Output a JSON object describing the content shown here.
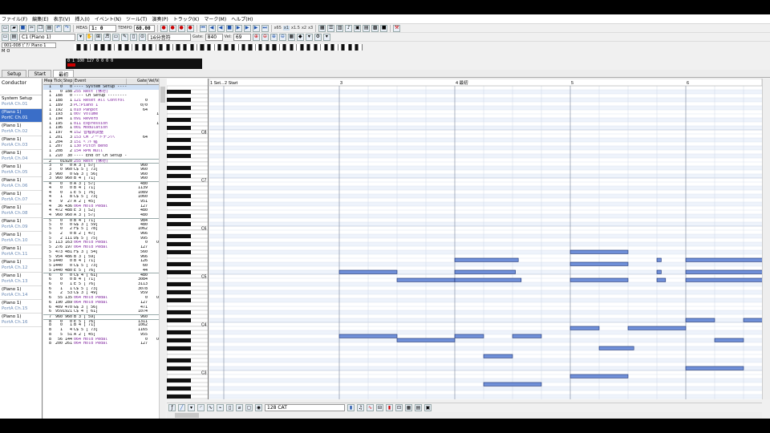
{
  "menu": [
    "ファイル(F)",
    "編集(E)",
    "表示(V)",
    "挿入(I)",
    "イベント(N)",
    "ツール(T)",
    "演奏(P)",
    "トラック(K)",
    "マーク(M)",
    "ヘルプ(H)"
  ],
  "transport": {
    "meas_label": "MEAS",
    "position": "1:   0",
    "tempo_label": "TEMPO",
    "tempo": "60.00",
    "buttons": [
      "x65",
      "x1",
      "x1.5",
      "x2",
      "x3"
    ]
  },
  "toolbar2": {
    "track_select": "C1 (Piano 1)",
    "quantize": "16分音符",
    "gate_label": "Gate:",
    "gate": "840",
    "vel_label": "Vel:",
    "vel": "69"
  },
  "trackinfo": {
    "name": "001-008 ﾋﾟｱﾉ Piano 1",
    "m": "M",
    "o": "O",
    "rows": [
      "0  1  100 127  0  0  0  0",
      "M  O"
    ]
  },
  "tabs": [
    "Setup",
    "Start",
    "最初"
  ],
  "tracks": {
    "header": "Conductor",
    "items": [
      {
        "name": "System Setup",
        "sub": "PortA Ch.01",
        "sel": false
      },
      {
        "name": "(Piano 1)",
        "sub": "PortC Ch.01",
        "sel": true
      },
      {
        "name": "(Piano 1)",
        "sub": "PortA Ch.02",
        "sel": false
      },
      {
        "name": "(Piano 1)",
        "sub": "PortA Ch.03",
        "sel": false
      },
      {
        "name": "(Piano 1)",
        "sub": "PortA Ch.04",
        "sel": false
      },
      {
        "name": "(Piano 1)",
        "sub": "PortA Ch.05",
        "sel": false
      },
      {
        "name": "(Piano 1)",
        "sub": "PortA Ch.06",
        "sel": false
      },
      {
        "name": "(Piano 1)",
        "sub": "PortA Ch.07",
        "sel": false
      },
      {
        "name": "(Piano 1)",
        "sub": "PortA Ch.08",
        "sel": false
      },
      {
        "name": "(Piano 1)",
        "sub": "PortA Ch.09",
        "sel": false
      },
      {
        "name": "(Piano 1)",
        "sub": "PortA Ch.10",
        "sel": false
      },
      {
        "name": "(Piano 1)",
        "sub": "PortA Ch.11",
        "sel": false
      },
      {
        "name": "(Piano 1)",
        "sub": "PortA Ch.12",
        "sel": false
      },
      {
        "name": "(Piano 1)",
        "sub": "PortA Ch.13",
        "sel": false
      },
      {
        "name": "(Piano 1)",
        "sub": "PortA Ch.14",
        "sel": false
      },
      {
        "name": "(Piano 1)",
        "sub": "PortA Ch.15",
        "sel": false
      },
      {
        "name": "(Piano 1)",
        "sub": "PortA Ch.16",
        "sel": false
      }
    ]
  },
  "list": {
    "headers": [
      "Mea",
      "Tick",
      "Step",
      "Event",
      "Gate",
      "Vel/Value"
    ],
    "rows": [
      [
        "1",
        "0",
        "0",
        "---- System Setup ----",
        "",
        ""
      ],
      [
        "1",
        "0",
        "188",
        "255 Rest (休符)",
        "",
        ""
      ],
      [
        "1",
        "188",
        "0",
        "---- CH Setup ---------",
        "",
        ""
      ],
      [
        "1",
        "188",
        "1",
        "121 Reset All Control",
        "0",
        "ON"
      ],
      [
        "1",
        "189",
        "3",
        "PC:Piano 1",
        "0/0",
        "1"
      ],
      [
        "1",
        "192",
        "1",
        "010 Panpot",
        "64",
        "±0"
      ],
      [
        "1",
        "193",
        "1",
        "007 Volume",
        "",
        "100"
      ],
      [
        "1",
        "194",
        "1",
        "091 Reverb",
        "",
        "0"
      ],
      [
        "1",
        "195",
        "1",
        "011 Expression",
        "",
        "127"
      ],
      [
        "1",
        "196",
        "1",
        "001 Modulation",
        "",
        "0"
      ],
      [
        "1",
        "197",
        "4",
        "152 音程表調整",
        "",
        "0"
      ],
      [
        "1",
        "201",
        "3",
        "153 CM ノートナンバ",
        "64",
        "±0"
      ],
      [
        "1",
        "204",
        "3",
        "151 ﾍﾞﾝﾄﾞ幅",
        "",
        "12"
      ],
      [
        "1",
        "207",
        "1",
        "130 Pitch Bend",
        "",
        "0"
      ],
      [
        "1",
        "208",
        "2",
        "154 RPN Null",
        "",
        ""
      ],
      [
        "1",
        "210",
        "30",
        "---- End of CH Setup ----",
        "",
        ""
      ],
      [
        "2",
        "0",
        "1920",
        "255 Rest (休符)",
        "",
        ""
      ],
      [
        "3",
        "0",
        "0",
        "A  3 [ 57]",
        "960",
        "69"
      ],
      [
        "3",
        "0",
        "960",
        "C$ 5 [ 73]",
        "960",
        "69"
      ],
      [
        "3",
        "960",
        "0",
        "G$ 3 [ 56]",
        "960",
        "69"
      ],
      [
        "3",
        "960",
        "960",
        "B  4 [ 71]",
        "960",
        "69"
      ],
      [
        "4",
        "0",
        "0",
        "A  3 [ 57]",
        "480",
        "69"
      ],
      [
        "4",
        "0",
        "0",
        "B  4 [ 71]",
        "1139",
        "56"
      ],
      [
        "4",
        "0",
        "1",
        "E  5 [ 76]",
        "1089",
        "60"
      ],
      [
        "4",
        "1",
        "8",
        "C$ 5 [ 73]",
        "1060",
        "64"
      ],
      [
        "4",
        "9",
        "27",
        "A  2 [ 45]",
        "951",
        "62"
      ],
      [
        "4",
        "36",
        "436",
        "064 Hold Pedal",
        "127",
        "ON"
      ],
      [
        "4",
        "472",
        "488",
        "E  3 [ 52]",
        "480",
        "53"
      ],
      [
        "4",
        "960",
        "960",
        "A  3 [ 57]",
        "480",
        "56"
      ],
      [
        "5",
        "0",
        "0",
        "B  4 [ 71]",
        "984",
        "57"
      ],
      [
        "5",
        "0",
        "0",
        "G$ 3 [ 59]",
        "480",
        "63"
      ],
      [
        "5",
        "0",
        "2",
        "F$ 5 [ 78]",
        "1062",
        "60"
      ],
      [
        "5",
        "2",
        "0",
        "B  2 [ 47]",
        "966",
        "57"
      ],
      [
        "5",
        "2",
        "111",
        "D$ 5 [ 75]",
        "995",
        "62"
      ],
      [
        "5",
        "113",
        "163",
        "064 Hold Pedal",
        "0",
        "OFF"
      ],
      [
        "5",
        "276",
        "197",
        "064 Hold Pedal",
        "127",
        "ON"
      ],
      [
        "5",
        "473",
        "481",
        "F$ 3 [ 54]",
        "560",
        "59"
      ],
      [
        "5",
        "954",
        "486",
        "B  3 [ 59]",
        "966",
        "68"
      ],
      [
        "5",
        "1440",
        "0",
        "B  4 [ 71]",
        "126",
        "57"
      ],
      [
        "5",
        "1440",
        "0",
        "C$ 5 [ 73]",
        "60",
        "64"
      ],
      [
        "5",
        "1440",
        "480",
        "E  5 [ 76]",
        "44",
        "71"
      ],
      [
        "6",
        "0",
        "0",
        "C$ 4 [ 61]",
        "480",
        "63"
      ],
      [
        "6",
        "0",
        "0",
        "B  4 [ 71]",
        "3084",
        "64"
      ],
      [
        "6",
        "0",
        "1",
        "E  5 [ 76]",
        "3113",
        "75"
      ],
      [
        "6",
        "1",
        "1",
        "C$ 5 [ 73]",
        "3078",
        "67"
      ],
      [
        "6",
        "2",
        "53",
        "C$ 3 [ 49]",
        "959",
        "56"
      ],
      [
        "6",
        "55",
        "135",
        "064 Hold Pedal",
        "0",
        "OFF"
      ],
      [
        "6",
        "190",
        "289",
        "064 Hold Pedal",
        "127",
        "ON"
      ],
      [
        "6",
        "409",
        "470",
        "G$ 3 [ 56]",
        "471",
        "54"
      ],
      [
        "6",
        "959",
        "1921",
        "C$ 4 [ 61]",
        "1074",
        "55"
      ],
      [
        "7",
        "960",
        "960",
        "B  3 [ 59]",
        "960",
        "69"
      ],
      [
        "8",
        "0",
        "0",
        "E  5 [ 76]",
        "1311",
        "68"
      ],
      [
        "8",
        "0",
        "1",
        "B  4 [ 71]",
        "1062",
        "59"
      ],
      [
        "8",
        "1",
        "4",
        "C$ 5 [ 73]",
        "1165",
        "57"
      ],
      [
        "8",
        "5",
        "51",
        "A  2 [ 45]",
        "955",
        "60"
      ],
      [
        "8",
        "56",
        "144",
        "064 Hold Pedal",
        "0",
        "OFF"
      ],
      [
        "8",
        "200",
        "261",
        "064 Hold Pedal",
        "127",
        "ON"
      ]
    ]
  },
  "roll": {
    "ruler": [
      "1 Set...",
      "2 Start",
      "3",
      "4 最初",
      "5",
      "6"
    ],
    "octaves": [
      "C8",
      "C7",
      "C6",
      "C5",
      "C4",
      "C3"
    ],
    "notes": [
      {
        "bar": 3,
        "beat": 0,
        "len": 2,
        "pitch": 73
      },
      {
        "bar": 3,
        "beat": 2,
        "len": 2,
        "pitch": 71
      },
      {
        "bar": 3,
        "beat": 0,
        "len": 2,
        "pitch": 57
      },
      {
        "bar": 3,
        "beat": 2,
        "len": 2,
        "pitch": 56
      },
      {
        "bar": 4,
        "beat": 0,
        "len": 2.2,
        "pitch": 76
      },
      {
        "bar": 4,
        "beat": 0,
        "len": 2.1,
        "pitch": 73
      },
      {
        "bar": 4,
        "beat": 0,
        "len": 2.3,
        "pitch": 71
      },
      {
        "bar": 4,
        "beat": 0,
        "len": 1,
        "pitch": 57
      },
      {
        "bar": 4,
        "beat": 1,
        "len": 1,
        "pitch": 52
      },
      {
        "bar": 4,
        "beat": 2,
        "len": 1,
        "pitch": 57
      },
      {
        "bar": 4,
        "beat": 1,
        "len": 2,
        "pitch": 45
      },
      {
        "bar": 5,
        "beat": 0,
        "len": 2,
        "pitch": 78
      },
      {
        "bar": 5,
        "beat": 0,
        "len": 2,
        "pitch": 75
      },
      {
        "bar": 5,
        "beat": 0,
        "len": 2,
        "pitch": 71
      },
      {
        "bar": 5,
        "beat": 0,
        "len": 1,
        "pitch": 59
      },
      {
        "bar": 5,
        "beat": 1,
        "len": 1.2,
        "pitch": 54
      },
      {
        "bar": 5,
        "beat": 2,
        "len": 2,
        "pitch": 59
      },
      {
        "bar": 5,
        "beat": 0,
        "len": 2,
        "pitch": 47
      },
      {
        "bar": 5,
        "beat": 3,
        "len": 0.15,
        "pitch": 76
      },
      {
        "bar": 5,
        "beat": 3,
        "len": 0.15,
        "pitch": 73
      },
      {
        "bar": 5,
        "beat": 3,
        "len": 0.3,
        "pitch": 71
      },
      {
        "bar": 6,
        "beat": 0,
        "len": 2.8,
        "pitch": 76
      },
      {
        "bar": 6,
        "beat": 0,
        "len": 2.8,
        "pitch": 73
      },
      {
        "bar": 6,
        "beat": 0,
        "len": 2.8,
        "pitch": 71
      },
      {
        "bar": 6,
        "beat": 0,
        "len": 1,
        "pitch": 61
      },
      {
        "bar": 6,
        "beat": 1,
        "len": 1,
        "pitch": 56
      },
      {
        "bar": 6,
        "beat": 2,
        "len": 2,
        "pitch": 61
      },
      {
        "bar": 6,
        "beat": 0,
        "len": 2,
        "pitch": 49
      }
    ]
  },
  "bottom": {
    "event_select": "128 CAT"
  }
}
